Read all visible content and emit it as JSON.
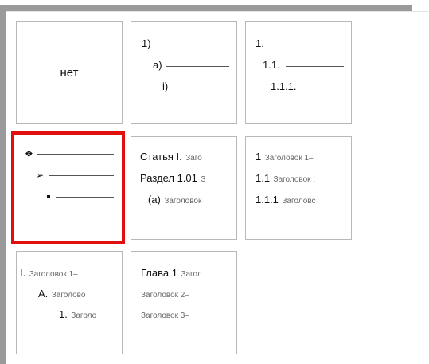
{
  "tiles": {
    "none": {
      "label": "нет"
    },
    "numbered_paren": {
      "levels": [
        "1)",
        "a)",
        "i)"
      ]
    },
    "decimal_outline": {
      "levels": [
        "1.",
        "1.1.",
        "1.1.1."
      ]
    },
    "bullets": {
      "icons": [
        "diamond-bullet-icon",
        "arrow-bullet-icon",
        "square-bullet-icon"
      ],
      "selected": true
    },
    "article_section": {
      "lines": [
        {
          "prefix": "Статья I.",
          "heading": "Заго"
        },
        {
          "prefix": "Раздел 1.01",
          "heading": "З"
        },
        {
          "prefix": "(a)",
          "heading": "Заголовок"
        }
      ]
    },
    "heading_numbered": {
      "lines": [
        {
          "prefix": "1",
          "heading": "Заголовок 1–"
        },
        {
          "prefix": "1.1",
          "heading": "Заголовок :"
        },
        {
          "prefix": "1.1.1",
          "heading": "Заголовс"
        }
      ]
    },
    "roman_heading": {
      "lines": [
        {
          "prefix": "I.",
          "heading": "Заголовок 1–"
        },
        {
          "prefix": "A.",
          "heading": "Заголово"
        },
        {
          "prefix": "1.",
          "heading": "Заголо"
        }
      ]
    },
    "chapter_heading": {
      "lines": [
        {
          "prefix": "Глава 1",
          "heading": "Загол"
        },
        {
          "prefix": "",
          "heading": "Заголовок 2–"
        },
        {
          "prefix": "",
          "heading": "Заголовок 3–"
        }
      ]
    }
  }
}
